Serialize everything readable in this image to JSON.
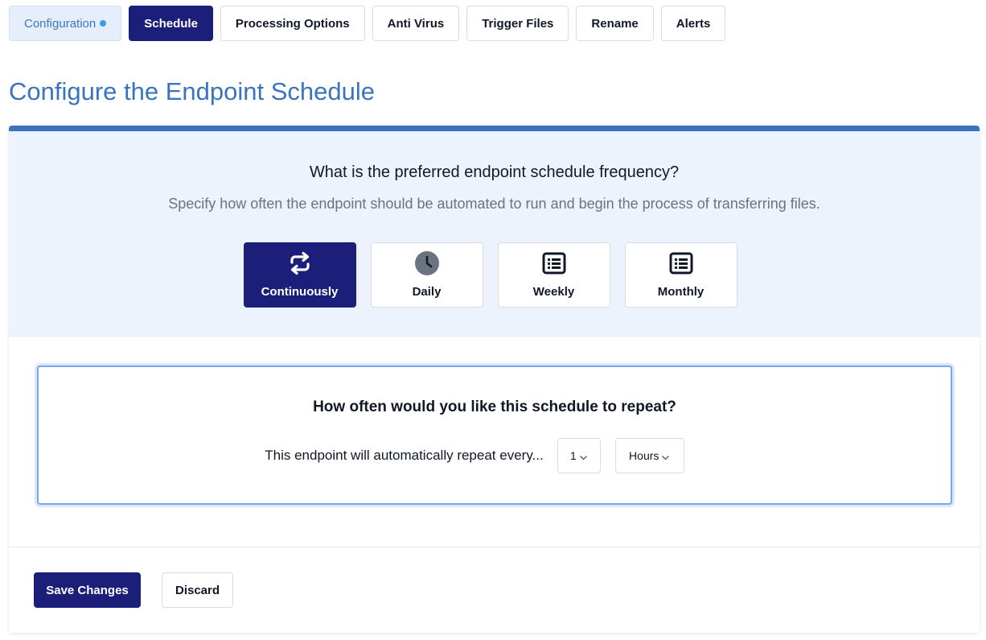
{
  "tabs": [
    {
      "label": "Configuration",
      "state": "configured"
    },
    {
      "label": "Schedule",
      "state": "active"
    },
    {
      "label": "Processing Options",
      "state": "default"
    },
    {
      "label": "Anti Virus",
      "state": "default"
    },
    {
      "label": "Trigger Files",
      "state": "default"
    },
    {
      "label": "Rename",
      "state": "default"
    },
    {
      "label": "Alerts",
      "state": "default"
    }
  ],
  "page": {
    "title": "Configure the Endpoint Schedule"
  },
  "frequency": {
    "question": "What is the preferred endpoint schedule frequency?",
    "description": "Specify how often the endpoint should be automated to run and begin the process of transferring files.",
    "options": [
      {
        "label": "Continuously",
        "icon": "repeat-arrows-icon",
        "selected": true
      },
      {
        "label": "Daily",
        "icon": "clock-icon",
        "selected": false
      },
      {
        "label": "Weekly",
        "icon": "list-icon",
        "selected": false
      },
      {
        "label": "Monthly",
        "icon": "list-icon",
        "selected": false
      }
    ]
  },
  "repeat": {
    "question": "How often would you like this schedule to repeat?",
    "text": "This endpoint will automatically repeat every...",
    "interval_value": "1",
    "interval_unit": "Hours"
  },
  "actions": {
    "save_label": "Save Changes",
    "discard_label": "Discard"
  },
  "colors": {
    "primary": "#1b1f7a",
    "accent": "#3a73c0",
    "panel_bg": "#edf3fd",
    "status_dot": "#3b9be8"
  }
}
